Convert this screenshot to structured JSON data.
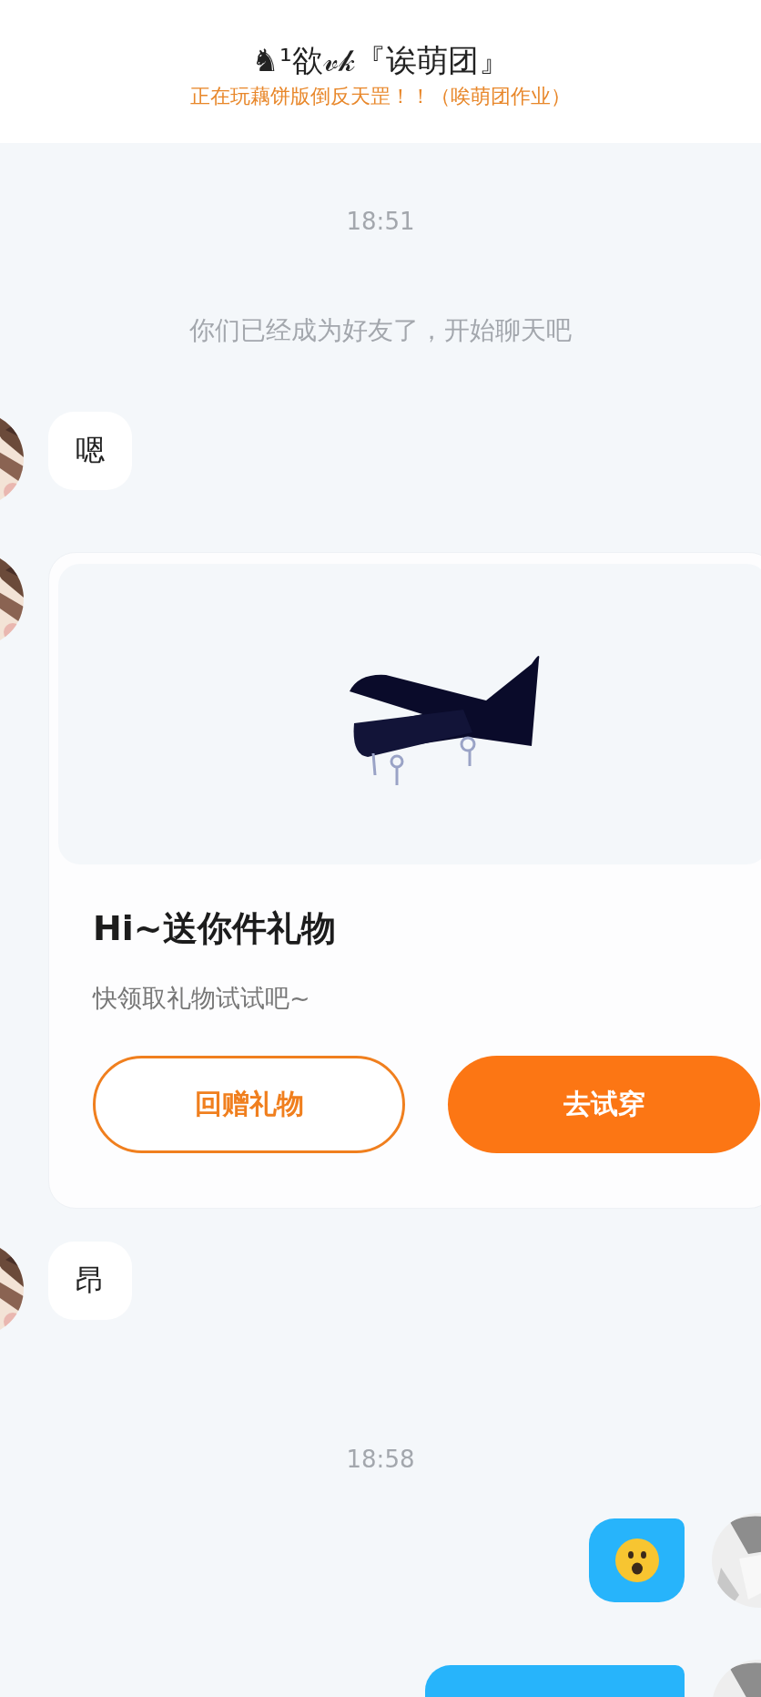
{
  "header": {
    "title": "♞¹欲𝓋𝓀『诶萌团』",
    "status": "正在玩藕饼版倒反天罡！！（唉萌团作业）"
  },
  "messages": [
    {
      "kind": "time",
      "text": "18:51"
    },
    {
      "kind": "system",
      "text": "你们已经成为好友了，开始聊天吧"
    },
    {
      "kind": "text",
      "outgoing": false,
      "text": "嗯"
    },
    {
      "kind": "gift_card",
      "outgoing": false,
      "title": "Hi~送你件礼物",
      "subtitle": "快领取礼物试试吧~",
      "buttons": [
        {
          "label": "回赠礼物",
          "primary": false
        },
        {
          "label": "去试穿",
          "primary": true
        }
      ]
    },
    {
      "kind": "text",
      "outgoing": false,
      "text": "昂"
    },
    {
      "kind": "time",
      "text": "18:58"
    },
    {
      "kind": "emoji",
      "outgoing": true
    },
    {
      "kind": "cut",
      "outgoing": true
    }
  ]
}
